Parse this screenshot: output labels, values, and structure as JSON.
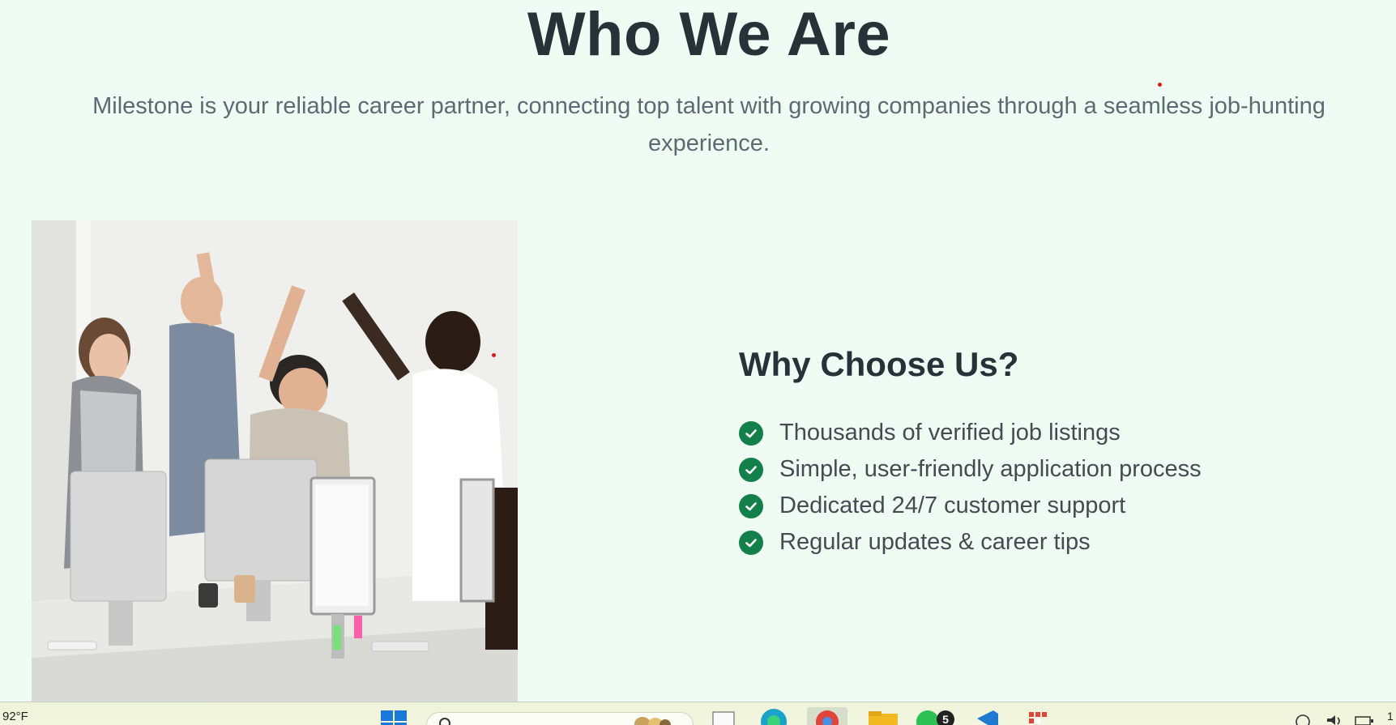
{
  "section": {
    "title": "Who We Are",
    "intro": "Milestone is your reliable career partner, connecting top talent with growing companies through a seamless job-hunting experience."
  },
  "why": {
    "title": "Why Choose Us?",
    "items": [
      "Thousands of verified job listings",
      "Simple, user-friendly application process",
      "Dedicated 24/7 customer support",
      "Regular updates & career tips"
    ]
  },
  "taskbar": {
    "weather": "92°F",
    "notification_count": "5",
    "tray_text": "1"
  },
  "colors": {
    "background": "#effcf3",
    "heading": "#263238",
    "accent_check": "#128048"
  }
}
